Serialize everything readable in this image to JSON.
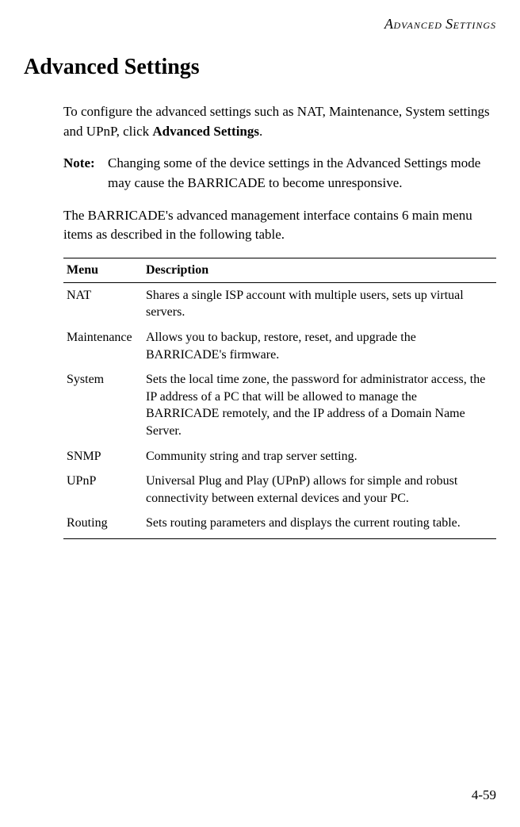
{
  "header": {
    "word1_first": "A",
    "word1_rest": "DVANCED",
    "word2_first": "S",
    "word2_rest": "ETTINGS"
  },
  "title": "Advanced Settings",
  "intro": {
    "part1": "To configure the advanced settings such as NAT, Maintenance, System settings and UPnP, click ",
    "bold": "Advanced Settings",
    "part2": "."
  },
  "note": {
    "label": "Note:",
    "text": "Changing some of the device settings in the Advanced Settings mode may cause the BARRICADE to become unresponsive."
  },
  "para2": "The BARRICADE's advanced management interface contains 6 main menu items as described in the following table.",
  "table": {
    "headers": {
      "menu": "Menu",
      "desc": "Description"
    },
    "rows": [
      {
        "menu": "NAT",
        "desc": "Shares a single ISP account with multiple users, sets up virtual servers."
      },
      {
        "menu": "Maintenance",
        "desc": "Allows you to backup, restore, reset, and upgrade the BARRICADE's firmware."
      },
      {
        "menu": "System",
        "desc": "Sets the local time zone, the password for administrator access, the IP address of a PC that will be allowed to manage the BARRICADE remotely, and the IP address of a Domain Name Server."
      },
      {
        "menu": "SNMP",
        "desc": "Community string and trap server setting."
      },
      {
        "menu": "UPnP",
        "desc": "Universal Plug and Play (UPnP) allows for simple and robust connectivity between external devices and your PC."
      },
      {
        "menu": "Routing",
        "desc": "Sets routing parameters and displays the current routing table."
      }
    ]
  },
  "pageNumber": "4-59"
}
